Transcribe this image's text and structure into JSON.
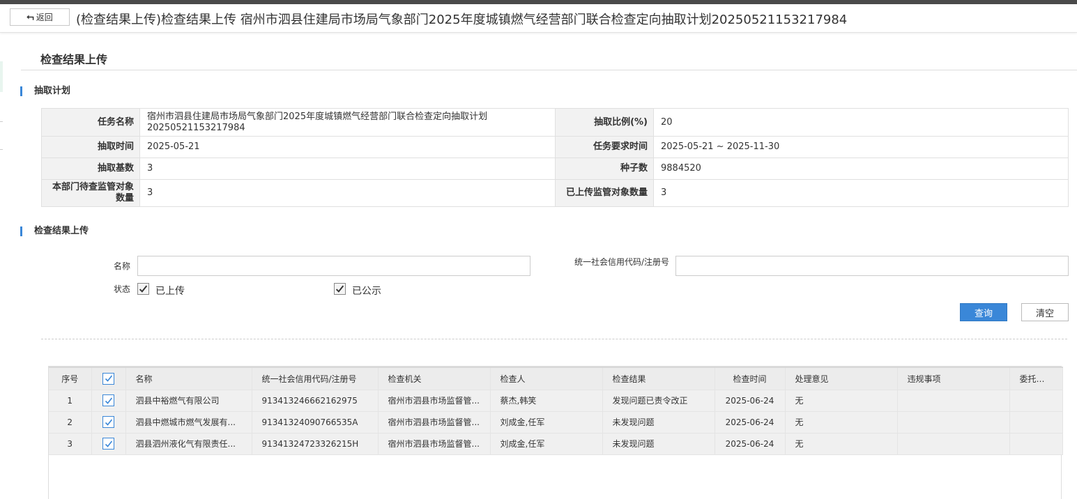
{
  "header": {
    "back_label": "返回",
    "title": "(检查结果上传)检查结果上传 宿州市泗县住建局市场局气象部门2025年度城镇燃气经营部门联合检查定向抽取计划20250521153217984"
  },
  "page_title": "检查结果上传",
  "plan_section": {
    "title": "抽取计划",
    "rows": [
      {
        "label1": "任务名称",
        "value1": "宿州市泗县住建局市场局气象部门2025年度城镇燃气经营部门联合检查定向抽取计划20250521153217984",
        "label2": "抽取比例(%)",
        "value2": "20"
      },
      {
        "label1": "抽取时间",
        "value1": "2025-05-21",
        "label2": "任务要求时间",
        "value2": "2025-05-21 ~ 2025-11-30"
      },
      {
        "label1": "抽取基数",
        "value1": "3",
        "label2": "种子数",
        "value2": "9884520"
      },
      {
        "label1": "本部门待查监管对象数量",
        "value1": "3",
        "label2": "已上传监管对象数量",
        "value2": "3"
      }
    ]
  },
  "upload_section": {
    "title": "检查结果上传",
    "name_label": "名称",
    "name_value": "",
    "code_label": "统一社会信用代码/注册号",
    "code_value": "",
    "status_label": "状态",
    "status_options": [
      {
        "label": "已上传",
        "checked": true
      },
      {
        "label": "已公示",
        "checked": true
      }
    ],
    "query_label": "查询",
    "clear_label": "清空"
  },
  "grid": {
    "columns": [
      "序号",
      "",
      "名称",
      "统一社会信用代码/注册号",
      "检查机关",
      "检查人",
      "检查结果",
      "检查时间",
      "处理意见",
      "违规事项",
      "委托部门"
    ],
    "rows": [
      {
        "no": "1",
        "name": "泗县中裕燃气有限公司",
        "code": "91341324666216297​5",
        "org": "宿州市泗县市场监督管...",
        "inspector": "蔡杰,韩笑",
        "result": "发现问题已责令改正",
        "date": "2025-06-24",
        "opinion": "无",
        "violation": "",
        "entrust": ""
      },
      {
        "no": "2",
        "name": "泗县中燃城市燃气发展有...",
        "code": "91341324090766535A",
        "org": "宿州市泗县市场监督管...",
        "inspector": "刘成金,任军",
        "result": "未发现问题",
        "date": "2025-06-24",
        "opinion": "无",
        "violation": "",
        "entrust": ""
      },
      {
        "no": "3",
        "name": "泗县泗州液化气有限责任...",
        "code": "91341324723326215H",
        "org": "宿州市泗县市场监督管...",
        "inspector": "刘成金,任军",
        "result": "未发现问题",
        "date": "2025-06-24",
        "opinion": "无",
        "violation": "",
        "entrust": ""
      }
    ]
  },
  "colors": {
    "accent": "#3a87d8"
  }
}
